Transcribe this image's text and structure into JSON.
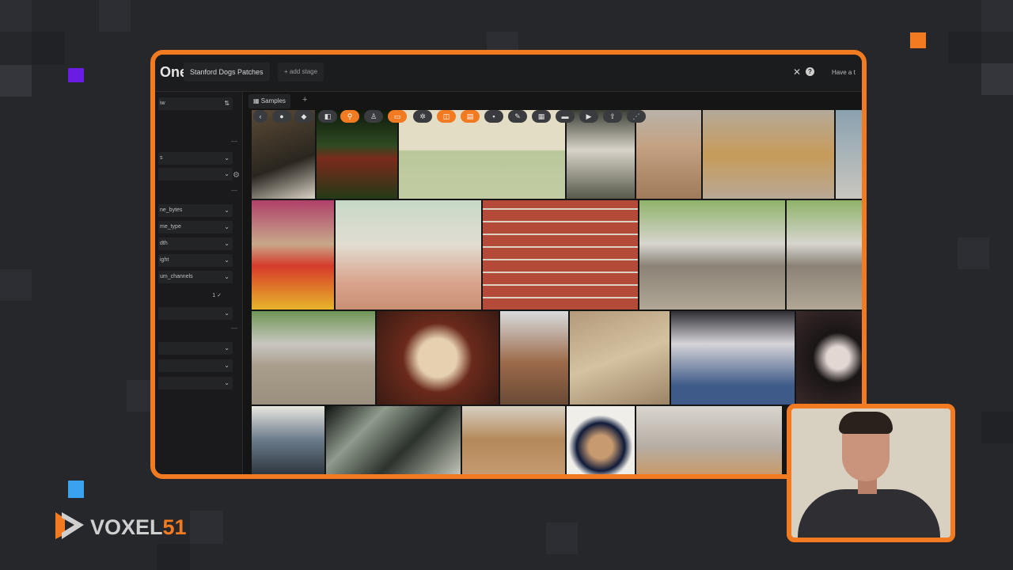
{
  "app": {
    "logo_text": "One",
    "dataset_name": "Stanford Dogs Patches",
    "add_stage_label": "+ add stage",
    "close_symbol": "✕",
    "help_symbol": "?",
    "right_text": "Have a t"
  },
  "tabs": {
    "samples_label": "Samples",
    "add_symbol": "+"
  },
  "sidebar": {
    "items": [
      {
        "label": "iw"
      },
      {
        "label": "s"
      },
      {
        "label": ""
      },
      {
        "label": "ne_bytes"
      },
      {
        "label": "me_type"
      },
      {
        "label": "dth"
      },
      {
        "label": "ight"
      },
      {
        "label": "um_channels"
      },
      {
        "label": "1 ✓"
      },
      {
        "label": ""
      },
      {
        "label": ""
      },
      {
        "label": ""
      },
      {
        "label": ""
      }
    ]
  },
  "toolbar": {
    "icons": [
      "chevron-left-icon",
      "tag-icon",
      "tag-icon",
      "patches-icon",
      "search-icon",
      "person-icon",
      "clips-icon",
      "settings-icon",
      "colors-icon",
      "filter-icon",
      "grid-icon",
      "edit-icon",
      "table-icon",
      "comment-icon",
      "video-icon",
      "upload-icon",
      "graph-icon"
    ]
  },
  "brand": {
    "name": "VOXEL",
    "number": "51"
  },
  "colors": {
    "accent": "#f27a21",
    "background": "#25272b"
  }
}
